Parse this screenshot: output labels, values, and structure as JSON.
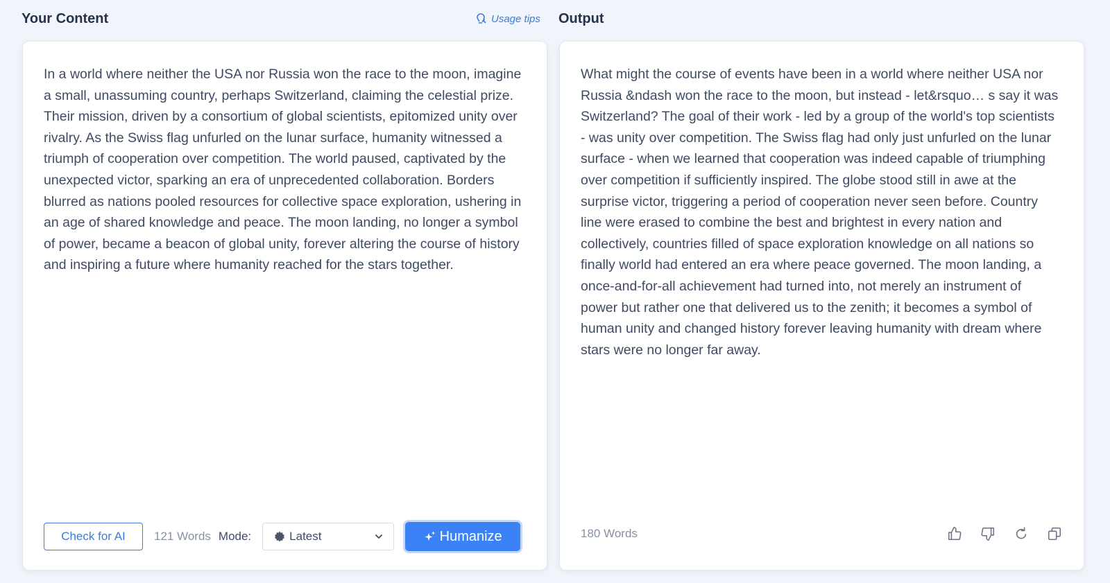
{
  "left_panel": {
    "title": "Your Content",
    "usage_tips": "Usage tips",
    "content": "In a world where neither the USA nor Russia won the race to the moon, imagine a small, unassuming country, perhaps Switzerland, claiming the celestial prize. Their mission, driven by a consortium of global scientists, epitomized unity over rivalry. As the Swiss flag unfurled on the lunar surface, humanity witnessed a triumph of cooperation over competition. The world paused, captivated by the unexpected victor, sparking an era of unprecedented collaboration. Borders blurred as nations pooled resources for collective space exploration, ushering in an age of shared knowledge and peace. The moon landing, no longer a symbol of power, became a beacon of global unity, forever altering the course of history and inspiring a future where humanity reached for the stars together.",
    "check_button": "Check for AI",
    "word_count": "121 Words",
    "mode_label": "Mode:",
    "mode_value": "Latest",
    "humanize_button": "Humanize"
  },
  "right_panel": {
    "title": "Output",
    "content": "What might the course of events have been in a world where neither USA nor Russia &ndash won the race to the moon, but instead - let&rsquo… s say it was Switzerland? The goal of their work - led by a group of the world's top scientists - was unity over competition. The Swiss flag had only just unfurled on the lunar surface - when we learned that cooperation was indeed capable of triumphing over competition if sufficiently inspired. The globe stood still in awe at the surprise victor, triggering a period of cooperation never seen before. Country line were erased to combine the best and brightest in every nation and collectively, countries filled of space exploration knowledge on all nations so finally world had entered an era where peace governed. The moon landing, a once-and-for-all achievement had turned into, not merely an instrument of power but rather one that delivered us to the zenith; it becomes a symbol of human unity and changed history forever leaving humanity with dream where stars were no longer far away.",
    "word_count": "180 Words",
    "icons": [
      "thumbs-up-icon",
      "thumbs-down-icon",
      "regenerate-icon",
      "copy-icon"
    ]
  },
  "colors": {
    "accent": "#3b82f6",
    "text": "#3f4a63",
    "muted": "#8791a3",
    "background": "#f1f5fb"
  }
}
